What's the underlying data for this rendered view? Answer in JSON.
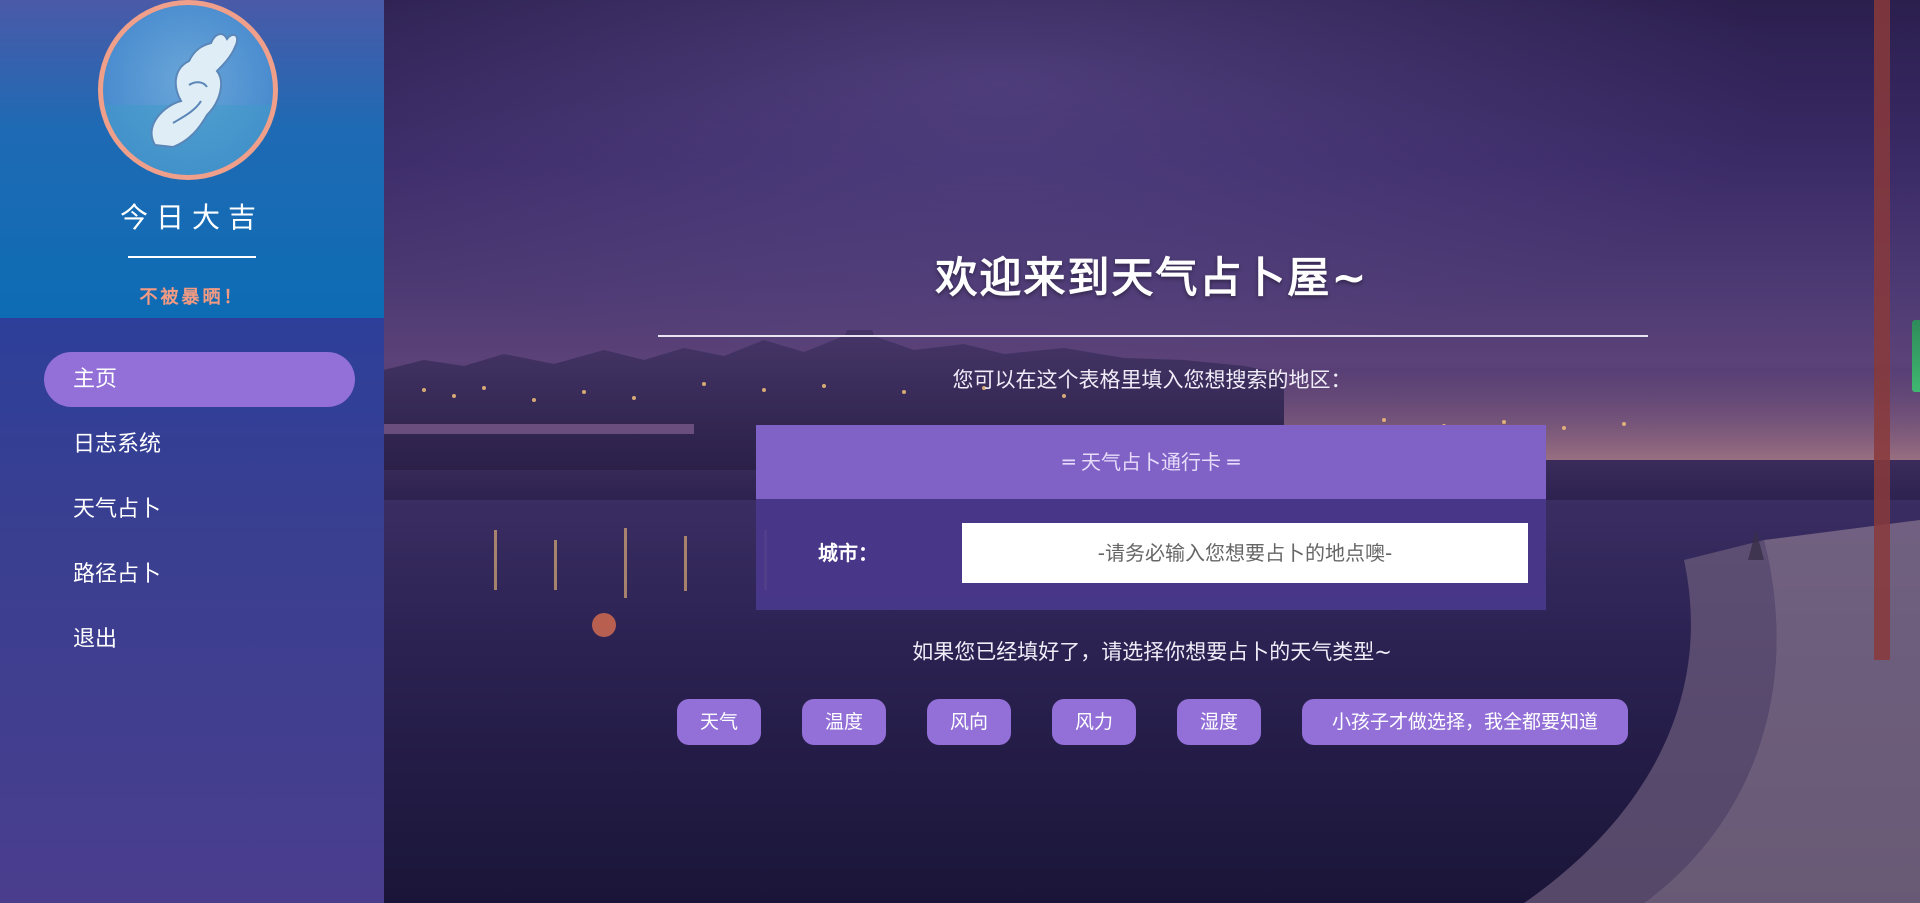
{
  "sidebar": {
    "site_name": "今日大吉",
    "motto": "不被暴晒！",
    "nav": [
      {
        "label": "主页",
        "active": true
      },
      {
        "label": "日志系统",
        "active": false
      },
      {
        "label": "天气占卜",
        "active": false
      },
      {
        "label": "路径占卜",
        "active": false
      },
      {
        "label": "退出",
        "active": false
      }
    ]
  },
  "main": {
    "title": "欢迎来到天气占卜屋~",
    "hint": "您可以在这个表格里填入您想搜索的地区：",
    "card": {
      "header": "═ 天气占卜通行卡 ═",
      "city_label": "城市：",
      "city_placeholder": "-请务必输入您想要占卜的地点噢-"
    },
    "hint2": "如果您已经填好了，请选择你想要占卜的天气类型~",
    "buttons": [
      "天气",
      "温度",
      "风向",
      "风力",
      "湿度",
      "小孩子才做选择，我全都要知道"
    ]
  },
  "colors": {
    "accent": "#9370d8",
    "card_header": "#8062c6",
    "motto": "#f39a82",
    "avatar_border": "#f0a08a"
  }
}
